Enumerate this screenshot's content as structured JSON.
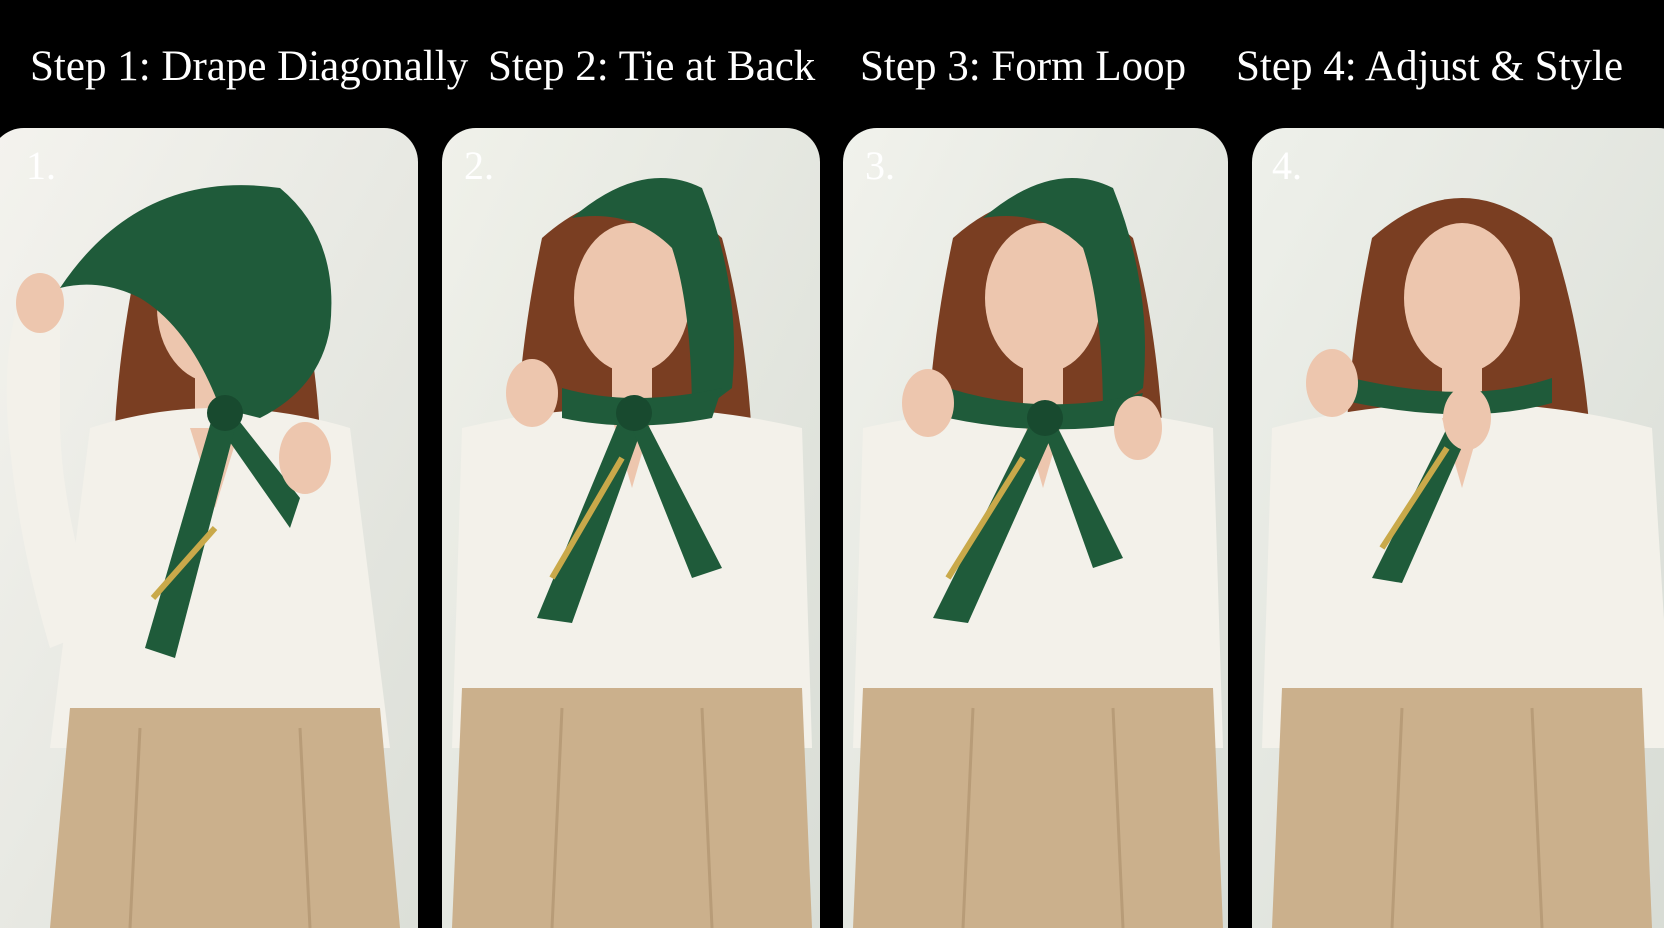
{
  "steps": [
    {
      "title": "Step 1: Drape Diagonally",
      "number": "1."
    },
    {
      "title": "Step 2: Tie at Back",
      "number": "2."
    },
    {
      "title": "Step 3: Form Loop",
      "number": "3."
    },
    {
      "title": "Step 4: Adjust & Style",
      "number": "4."
    }
  ],
  "colors": {
    "header_bg": "#000000",
    "scarf": "#1f5b3a",
    "scarf_trim": "#c9a94a",
    "hair": "#7a3e22",
    "skin": "#edc6ae",
    "blouse": "#f3f1ea",
    "trousers": "#cbb08c",
    "wall": "#e9ebe4"
  }
}
